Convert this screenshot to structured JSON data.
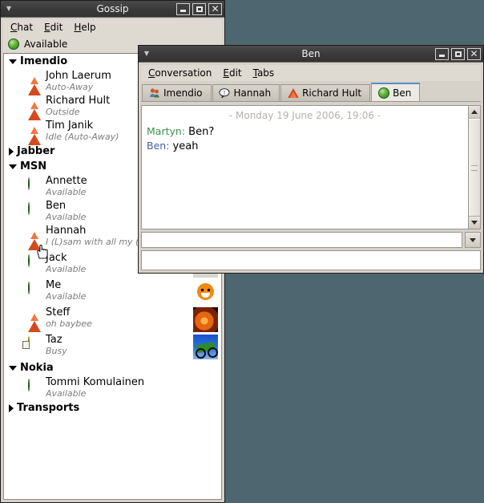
{
  "desktop": {
    "background": "#4d6670"
  },
  "gossip_window": {
    "title": "Gossip",
    "titlebar_buttons": {
      "minimize": "minimize",
      "maximize": "maximize",
      "close": "close"
    },
    "menu": [
      {
        "label": "Chat",
        "mnemonic": "C"
      },
      {
        "label": "Edit",
        "mnemonic": "E"
      },
      {
        "label": "Help",
        "mnemonic": "H"
      }
    ],
    "own_status": {
      "label": "Available",
      "icon": "available-icon"
    },
    "groups": [
      {
        "name": "Imendio",
        "expanded": true,
        "contacts": [
          {
            "name": "John Laerum",
            "status": "Auto-Away",
            "icon": "away-icon",
            "avatar": null
          },
          {
            "name": "Richard Hult",
            "status": "Outside",
            "icon": "away-icon",
            "avatar": null
          },
          {
            "name": "Tim Janik",
            "status": "Idle (Auto-Away)",
            "icon": "away-icon",
            "avatar": null
          }
        ]
      },
      {
        "name": "Jabber",
        "expanded": false,
        "contacts": []
      },
      {
        "name": "MSN",
        "expanded": true,
        "contacts": [
          {
            "name": "Annette",
            "status": "Available",
            "icon": "available-icon",
            "avatar": null
          },
          {
            "name": "Ben",
            "status": "Available",
            "icon": "available-icon",
            "avatar": null
          },
          {
            "name": "Hannah",
            "status": "I (L)sam with all my (L)(so)IT…",
            "icon": "away-icon",
            "avatar": "photo-landscape"
          },
          {
            "name": "Jack",
            "status": "Available",
            "icon": "available-icon",
            "avatar": "photo-man"
          },
          {
            "name": "Me",
            "status": "Available",
            "icon": "available-icon",
            "avatar": "orange-smiley"
          },
          {
            "name": "Steff",
            "status": "oh baybee",
            "icon": "away-icon",
            "avatar": "photo-fire"
          },
          {
            "name": "Taz",
            "status": "Busy",
            "icon": "busy-icon",
            "avatar": "photo-motocross"
          }
        ]
      },
      {
        "name": "Nokia",
        "expanded": true,
        "contacts": [
          {
            "name": "Tommi Komulainen",
            "status": "Available",
            "icon": "available-icon",
            "avatar": null
          }
        ]
      },
      {
        "name": "Transports",
        "expanded": false,
        "contacts": []
      }
    ]
  },
  "chat_window": {
    "title": "Ben",
    "menu": [
      {
        "label": "Conversation",
        "mnemonic": "C"
      },
      {
        "label": "Edit",
        "mnemonic": "E"
      },
      {
        "label": "Tabs",
        "mnemonic": "T"
      }
    ],
    "tabs": [
      {
        "label": "Imendio",
        "icon": "group-chat-icon",
        "active": false
      },
      {
        "label": "Hannah",
        "icon": "speech-bubble-icon",
        "active": false
      },
      {
        "label": "Richard Hult",
        "icon": "away-icon",
        "active": false
      },
      {
        "label": "Ben",
        "icon": "available-icon",
        "active": true
      }
    ],
    "transcript": {
      "timestamp": "- Monday 19 June 2006, 19:06 -",
      "messages": [
        {
          "nick": "Martyn:",
          "text": "Ben?",
          "color": "#3f8f4f"
        },
        {
          "nick": "Ben:",
          "text": "yeah",
          "color": "#3f5f9f"
        }
      ]
    },
    "input": {
      "value": "",
      "placeholder": ""
    },
    "secondary_input": {
      "value": "",
      "placeholder": ""
    },
    "scrollbar": {
      "up": "scroll-up-arrow",
      "down": "scroll-down-arrow"
    },
    "combo_button": "dropdown-arrow"
  }
}
